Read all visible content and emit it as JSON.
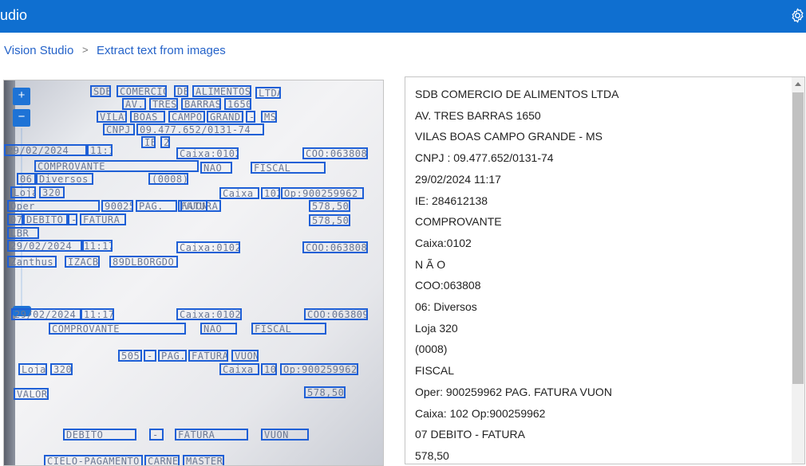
{
  "header": {
    "title": "udio",
    "settings_icon": "gear-icon"
  },
  "breadcrumb": {
    "items": [
      "Vision Studio",
      "Extract text from images"
    ],
    "separator": ">"
  },
  "image_viewer": {
    "zoom_in_label": "+",
    "zoom_out_label": "−",
    "ocr_regions": [
      "SDB",
      "COMERCIO",
      "DE",
      "ALIMENTOS",
      "LTDA",
      "AV.",
      "TRES",
      "BARRAS",
      "1650",
      "VILAS",
      "BOAS",
      "CAMPO",
      "GRANDE",
      "-",
      "MS",
      "CNPJ",
      "09.477.652/0131-74",
      "IE",
      "284612138",
      "29/02/2024",
      "11:17",
      "Caixa:0102",
      "COO:063808",
      "COMPROVANTE",
      "NÃO",
      "FISCAL",
      "06",
      "Diversos",
      "(0008)",
      "Loja",
      "320",
      "Caixa",
      "102",
      "Op:900259962",
      "Oper",
      "900259962",
      "PAG.",
      "FATURA",
      "VUON",
      "578,50",
      "07",
      "DEBITO",
      "-",
      "FATURA",
      "578,50",
      "LBR",
      "29/02/2024",
      "11:17",
      "Caixa:0102",
      "COO:063808",
      "Zanthus",
      "IZACB",
      "89DLBORGDO",
      "29/02/2024",
      "11:17",
      "Caixa:0102",
      "COO:063809",
      "COMPROVANTE",
      "NÃO",
      "FISCAL",
      "505",
      "-",
      "PAG.",
      "FATURA",
      "VUON",
      "Loja",
      "320",
      "Caixa",
      "102",
      "Op:900259962",
      "VALOR",
      "578,50",
      "DEBITO",
      "-",
      "FATURA",
      "VUON",
      "CIELO-PAGAMENTO",
      "CARNE",
      "MASTER"
    ]
  },
  "extracted_text": {
    "lines": [
      "SDB COMERCIO DE ALIMENTOS LTDA",
      "AV. TRES BARRAS 1650",
      "VILAS BOAS CAMPO GRANDE - MS",
      "CNPJ : 09.477.652/0131-74",
      "29/02/2024 11:17",
      "IE: 284612138",
      "COMPROVANTE",
      "Caixa:0102",
      "N Ã O",
      "COO:063808",
      "06: Diversos",
      "Loja 320",
      "(0008)",
      "FISCAL",
      "Oper: 900259962 PAG. FATURA VUON",
      "Caixa: 102 Op:900259962",
      "07 DEBITO - FATURA",
      "578,50"
    ]
  },
  "colors": {
    "header_bg": "#0f6fd0",
    "link": "#2563c9",
    "ocr_box": "#1e5fd6"
  }
}
